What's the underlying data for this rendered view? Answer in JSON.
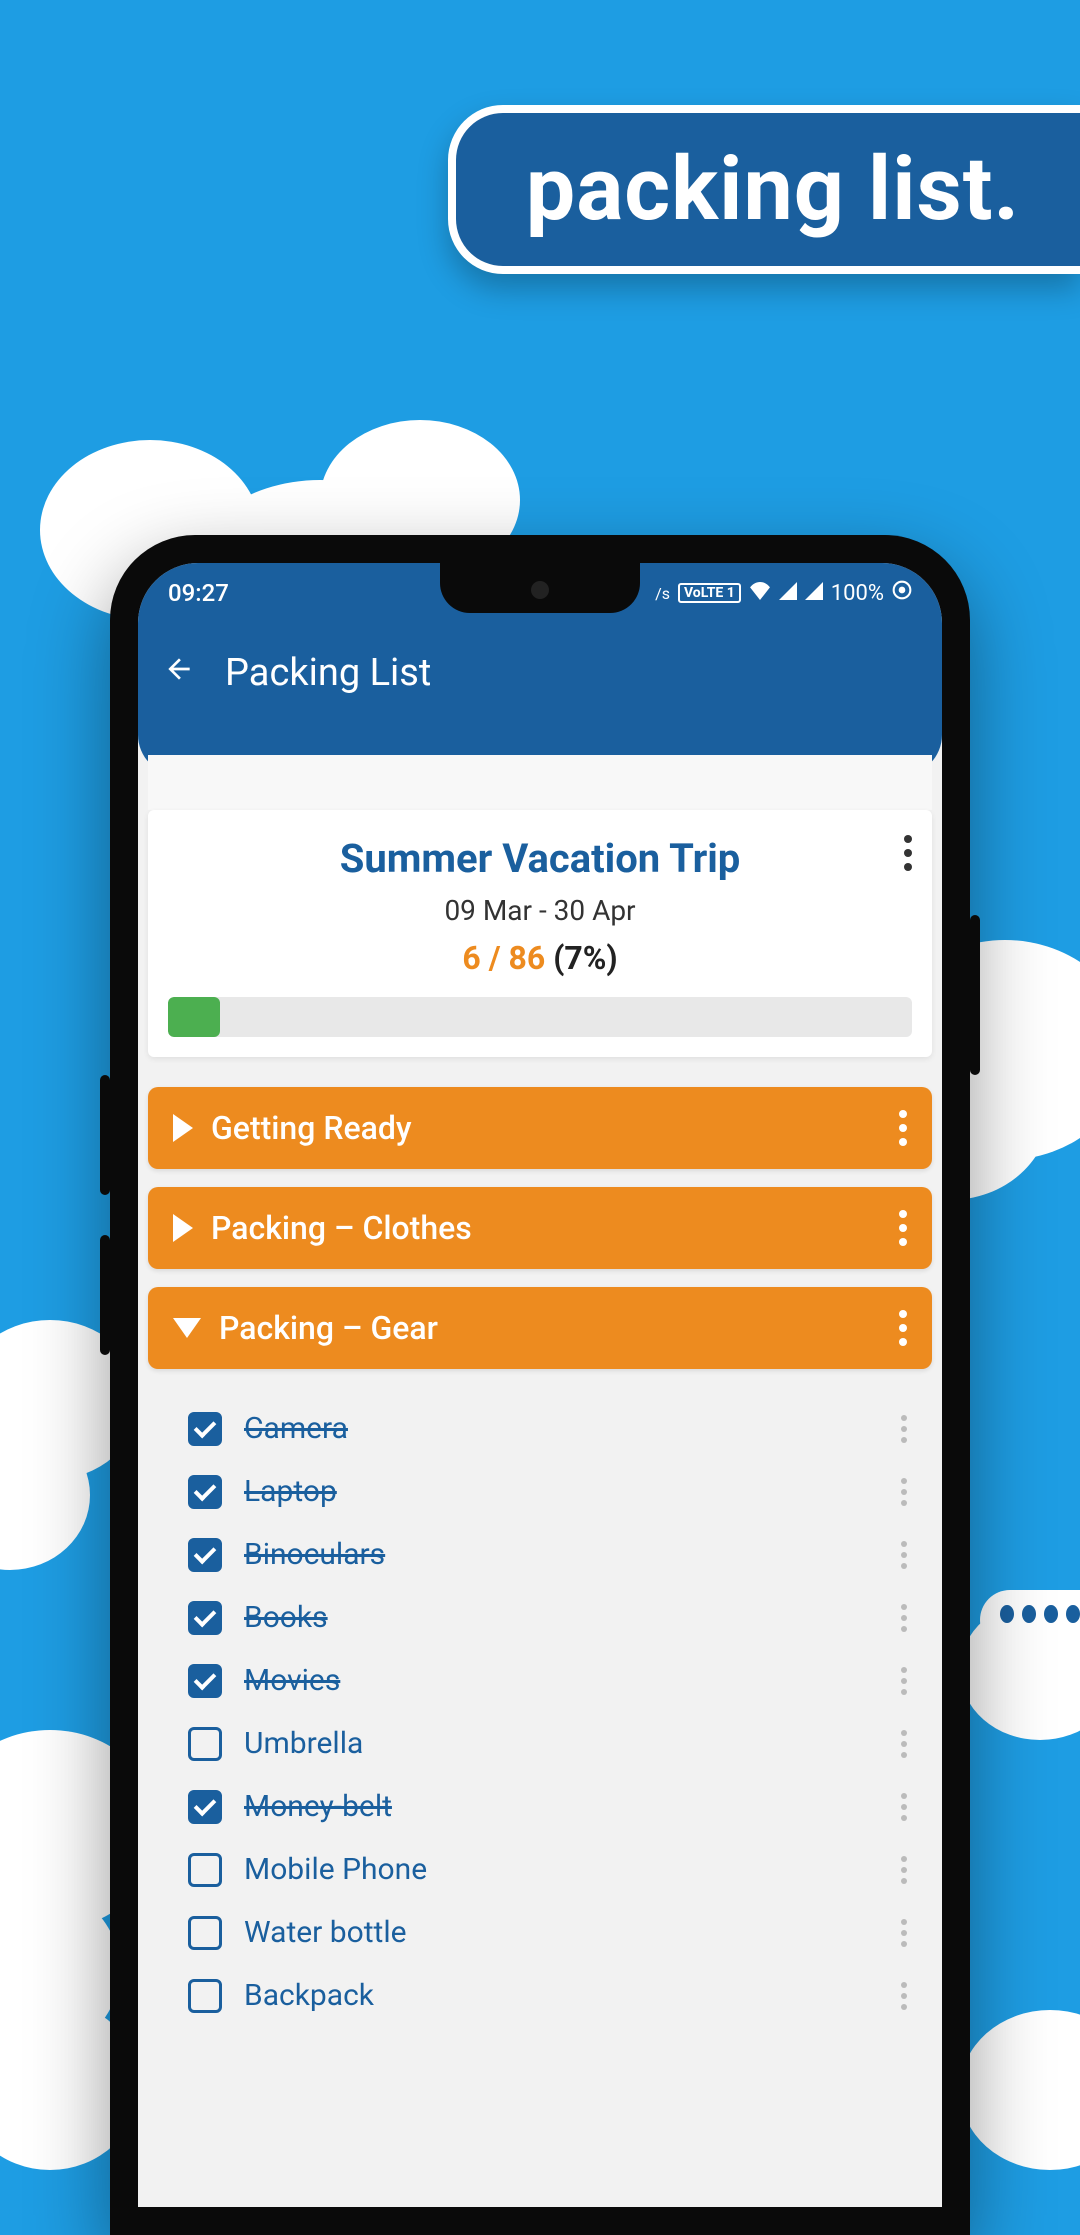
{
  "banner": {
    "label": "packing list."
  },
  "status": {
    "time": "09:27",
    "volte": "VoLTE 1",
    "battery": "100%"
  },
  "app_bar": {
    "title": "Packing List"
  },
  "summary": {
    "trip_title": "Summer Vacation Trip",
    "date_range": "09 Mar - 30 Apr",
    "done_count": "6 / 86",
    "percent": "(7%)",
    "progress_width": "7%"
  },
  "sections": [
    {
      "title": "Getting Ready",
      "expanded": false
    },
    {
      "title": "Packing – Clothes",
      "expanded": false
    },
    {
      "title": "Packing – Gear",
      "expanded": true
    }
  ],
  "items": [
    {
      "label": "Camera",
      "checked": true
    },
    {
      "label": "Laptop",
      "checked": true
    },
    {
      "label": "Binoculars",
      "checked": true
    },
    {
      "label": "Books",
      "checked": true
    },
    {
      "label": "Movies",
      "checked": true
    },
    {
      "label": "Umbrella",
      "checked": false
    },
    {
      "label": "Money-belt",
      "checked": true
    },
    {
      "label": "Mobile Phone",
      "checked": false
    },
    {
      "label": "Water bottle",
      "checked": false
    },
    {
      "label": "Backpack",
      "checked": false
    }
  ]
}
